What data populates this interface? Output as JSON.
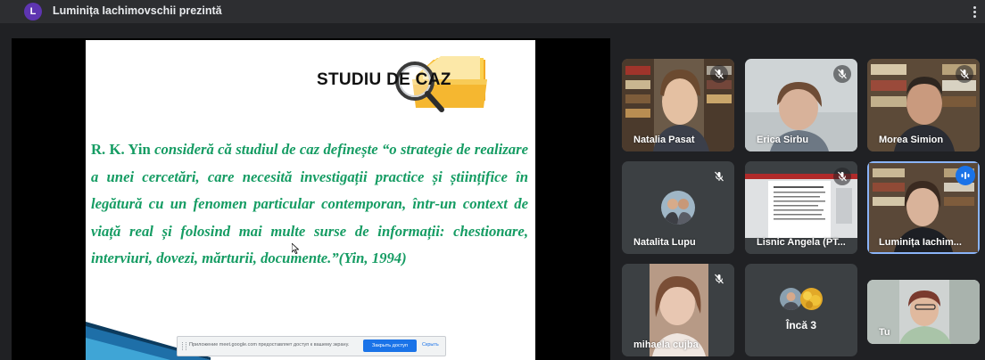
{
  "topbar": {
    "avatar_letter": "L",
    "presenting_label": "Luminița Iachimovschii prezintă"
  },
  "slide": {
    "title": "STUDIU DE CAZ",
    "author": "R. K. Yin",
    "body": " consideră că studiul de caz definește  “o strategie de realizare a unei cercetări, care necesită investigații practice și științifice în legătură cu un fenomen particular contemporan, într-un context de viață real și folosind mai multe surse de informații: chestionare, interviuri, dovezi, mărturii, documente.”(Yin, 1994)",
    "text_color": "#159c63"
  },
  "share_banner": {
    "message": "Приложение meet.google.com предоставляет доступ к вашему экрану.",
    "stop_label": "Закрыть доступ",
    "hide_label": "Скрыть"
  },
  "participants": [
    {
      "name": "Natalia Pasat",
      "mic": "muted"
    },
    {
      "name": "Erica Sirbu",
      "mic": "muted"
    },
    {
      "name": "Morea Simion",
      "mic": "muted"
    },
    {
      "name": "Natalita Lupu",
      "mic": "muted"
    },
    {
      "name": "Lisnic Angela (PT...",
      "mic": "muted"
    },
    {
      "name": "Luminița Iachim...",
      "mic": "speaking"
    },
    {
      "name": "mihaela cujba",
      "mic": "muted"
    },
    {
      "name": "Încă 3",
      "mic": "none"
    },
    {
      "name": "Tu",
      "mic": "none"
    }
  ],
  "icons": {
    "mic_off": "mic-off-icon",
    "speaking": "audio-level-icon",
    "more": "more-vert-icon"
  }
}
